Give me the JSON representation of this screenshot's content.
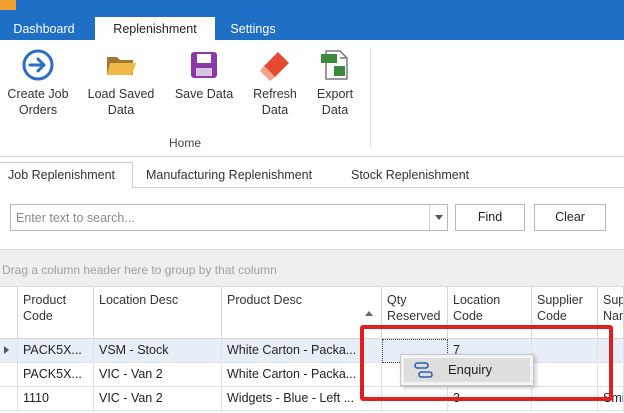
{
  "ribbon_tabs": [
    "Dashboard",
    "Replenishment",
    "Settings"
  ],
  "ribbon": {
    "buttons": [
      {
        "label": "Create Job\nOrders",
        "icon": "arrow-right-circle-icon"
      },
      {
        "label": "Load Saved\nData",
        "icon": "folder-icon"
      },
      {
        "label": "Save Data",
        "icon": "save-icon"
      },
      {
        "label": "Refresh\nData",
        "icon": "eraser-icon"
      },
      {
        "label": "Export\nData",
        "icon": "xls-export-icon"
      }
    ],
    "group_label": "Home"
  },
  "sub_tabs": [
    "Job Replenishment",
    "Manufacturing Replenishment",
    "Stock Replenishment"
  ],
  "search": {
    "placeholder": "Enter text to search...",
    "find_label": "Find",
    "clear_label": "Clear"
  },
  "group_panel_text": "Drag a column header here to group by that column",
  "grid": {
    "columns": [
      "Product\nCode",
      "Location Desc",
      "Product Desc",
      "Qty\nReserved",
      "Location\nCode",
      "Supplier\nCode",
      "Sup\nNam"
    ],
    "rows": [
      [
        "PACK5X...",
        "VSM - Stock",
        "White Carton - Packa...",
        "",
        "7",
        "",
        ""
      ],
      [
        "PACK5X...",
        "VIC - Van 2",
        "White Carton - Packa...",
        "",
        "",
        "",
        ""
      ],
      [
        "1110",
        "VIC - Van 2",
        "Widgets - Blue - Left ...",
        "-",
        "3",
        "",
        "Smi"
      ]
    ]
  },
  "context_menu": {
    "item_label": "Enquiry",
    "icon": "enquiry-icon"
  },
  "colors": {
    "ribbon_blue": "#1f6fc6",
    "highlight_red": "#e02020",
    "selection": "#e8eef8"
  }
}
